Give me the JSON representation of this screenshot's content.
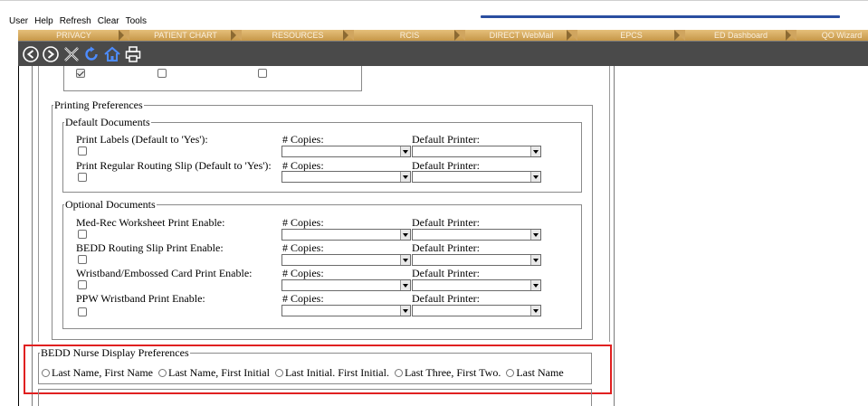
{
  "menu": {
    "items": [
      {
        "label": "User"
      },
      {
        "label": "Help"
      },
      {
        "label": "Refresh"
      },
      {
        "label": "Clear"
      },
      {
        "label": "Tools"
      }
    ]
  },
  "tabs": [
    {
      "label": "PRIVACY"
    },
    {
      "label": "PATIENT CHART"
    },
    {
      "label": "RESOURCES"
    },
    {
      "label": "RCIS"
    },
    {
      "label": "DIRECT WebMail"
    },
    {
      "label": "EPCS"
    },
    {
      "label": "ED Dashboard"
    },
    {
      "label": "QO Wizard"
    }
  ],
  "toolbar": {
    "icons": [
      "back-icon",
      "forward-icon",
      "close-icon",
      "refresh-icon",
      "home-icon",
      "print-icon"
    ]
  },
  "colors": {
    "toolbar": "#4a4a4a",
    "tab": "#d0a55f",
    "tab_text": "#fbf1df",
    "highlight": "#e02020",
    "progress": "#2a4ea0"
  },
  "top_checkboxes": [
    {
      "checked": true
    },
    {
      "checked": false
    },
    {
      "checked": false
    }
  ],
  "printing": {
    "legend": "Printing Preferences",
    "default_documents": {
      "legend": "Default Documents",
      "rows": [
        {
          "label": "Print Labels (Default to 'Yes'):",
          "copies_label": "# Copies:",
          "printer_label": "Default Printer:",
          "checked": false
        },
        {
          "label": "Print Regular Routing Slip (Default to 'Yes'):",
          "copies_label": "# Copies:",
          "printer_label": "Default Printer:",
          "checked": false
        }
      ]
    },
    "optional_documents": {
      "legend": "Optional Documents",
      "rows": [
        {
          "label": "Med-Rec Worksheet Print Enable:",
          "copies_label": "# Copies:",
          "printer_label": "Default Printer:",
          "checked": false
        },
        {
          "label": "BEDD Routing Slip Print Enable:",
          "copies_label": "# Copies:",
          "printer_label": "Default Printer:",
          "checked": false
        },
        {
          "label": "Wristband/Embossed Card Print Enable:",
          "copies_label": "# Copies:",
          "printer_label": "Default Printer:",
          "checked": false
        },
        {
          "label": "PPW Wristband Print Enable:",
          "copies_label": "# Copies:",
          "printer_label": "Default Printer:",
          "checked": false
        }
      ]
    }
  },
  "nurse_display": {
    "legend": "BEDD Nurse Display Preferences",
    "options": [
      {
        "label": "Last Name, First Name",
        "selected": false
      },
      {
        "label": "Last Name, First Initial",
        "selected": false
      },
      {
        "label": "Last Initial. First Initial.",
        "selected": false
      },
      {
        "label": "Last Three, First Two.",
        "selected": false
      },
      {
        "label": "Last Name",
        "selected": false
      }
    ]
  }
}
